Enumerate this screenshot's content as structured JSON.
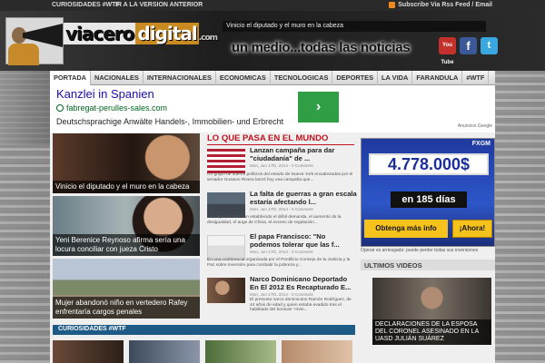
{
  "topbar": {
    "links": [
      "CURIOSIDADES #WTF",
      "IR A LA VERSION ANTERIOR"
    ],
    "rss": "Subscribe Via Rss Feed / Email"
  },
  "header": {
    "logo_part1": "viacero",
    "logo_part2": "digital",
    "logo_suffix": ".com",
    "ticker": "Vinicio el diputado y el muro en la cabeza",
    "slogan": "un medio...todas las noticias",
    "social": [
      "You Tube",
      "f",
      "t"
    ]
  },
  "nav": {
    "items": [
      "PORTADA",
      "NACIONALES",
      "INTERNACIONALES",
      "ECONOMICAS",
      "TECNOLOGICAS",
      "DEPORTES",
      "LA VIDA",
      "FARANDULA",
      "#WTF"
    ]
  },
  "ad": {
    "title": "Kanzlei in Spanien",
    "url": "fabregat-perulles-sales.com",
    "description": "Deutschsprachige Anwälte Handels-, Immobilien- und Erbrecht",
    "arrow": "›",
    "google_label": "Anuncios Google"
  },
  "featured": [
    {
      "caption": "Vinicio el diputado y el muro en la cabeza"
    },
    {
      "caption": "Yeni Berenice Reynoso afirma sería una locura conciliar con jueza Cristo"
    },
    {
      "caption": "Mujer abandonó niño en vertedero Rafey enfrentaría cargos penales"
    }
  ],
  "news_section": {
    "heading": "LO QUE PASA EN EL MUNDO",
    "items": [
      {
        "title": "Lanzan campaña para dar \"ciudadanía\" de ...",
        "meta": "Mon, Jun 17th, 2014 - 0 Comment",
        "excerpt": "Un grupo de líderes políticos del estado de Nueva York encabezados por el senador Gustavo Rivera lanzó hoy una campaña que..."
      },
      {
        "title": "La falta de guerras a gran escala estaría afectando l...",
        "meta": "Mon, Jun 17th, 2014 - 0 Comment",
        "excerpt": "Los especialistas han establecido el débil demanda, el aumento de la desigualdad, el auge de China, el exceso de regulación..."
      },
      {
        "title": "El papa Francisco: \"No podemos tolerar que las f...",
        "meta": "Mon, Jun 17th, 2014 - 0 Comment",
        "excerpt": "En una conferencia organizada por el Pontificio Consejo de la Justicia y la Paz sobre inversión para combatir la pobreza y..."
      },
      {
        "title": "Narco Dominicano Deportado En El 2012 Es Recapturado E...",
        "meta": "Mon, Jun 17th, 2014 - 0 Comment",
        "excerpt": "El presunto narco dominicano Ramón Rodríguez, de 44 años de edad y quien estaba evadido tras el habilitado del bonicas \"Alvin..."
      }
    ]
  },
  "curiosidades": {
    "heading": "CURIOSIDADES #WTF"
  },
  "banner": {
    "brand": "FXGM",
    "amount": "4.778.000$",
    "days": "en 185 días",
    "more": "Obtenga más info",
    "now": "¡Ahora!",
    "note": "Operar es arriesgado: puede perder todas sus inversiones"
  },
  "videos": {
    "heading": "ULTIMOS VIDEOS",
    "caption": "DECLARACIONES DE LA ESPOSA DEL CORONEL ASESINADO EN LA UASD JULIÁN SUÁREZ"
  }
}
